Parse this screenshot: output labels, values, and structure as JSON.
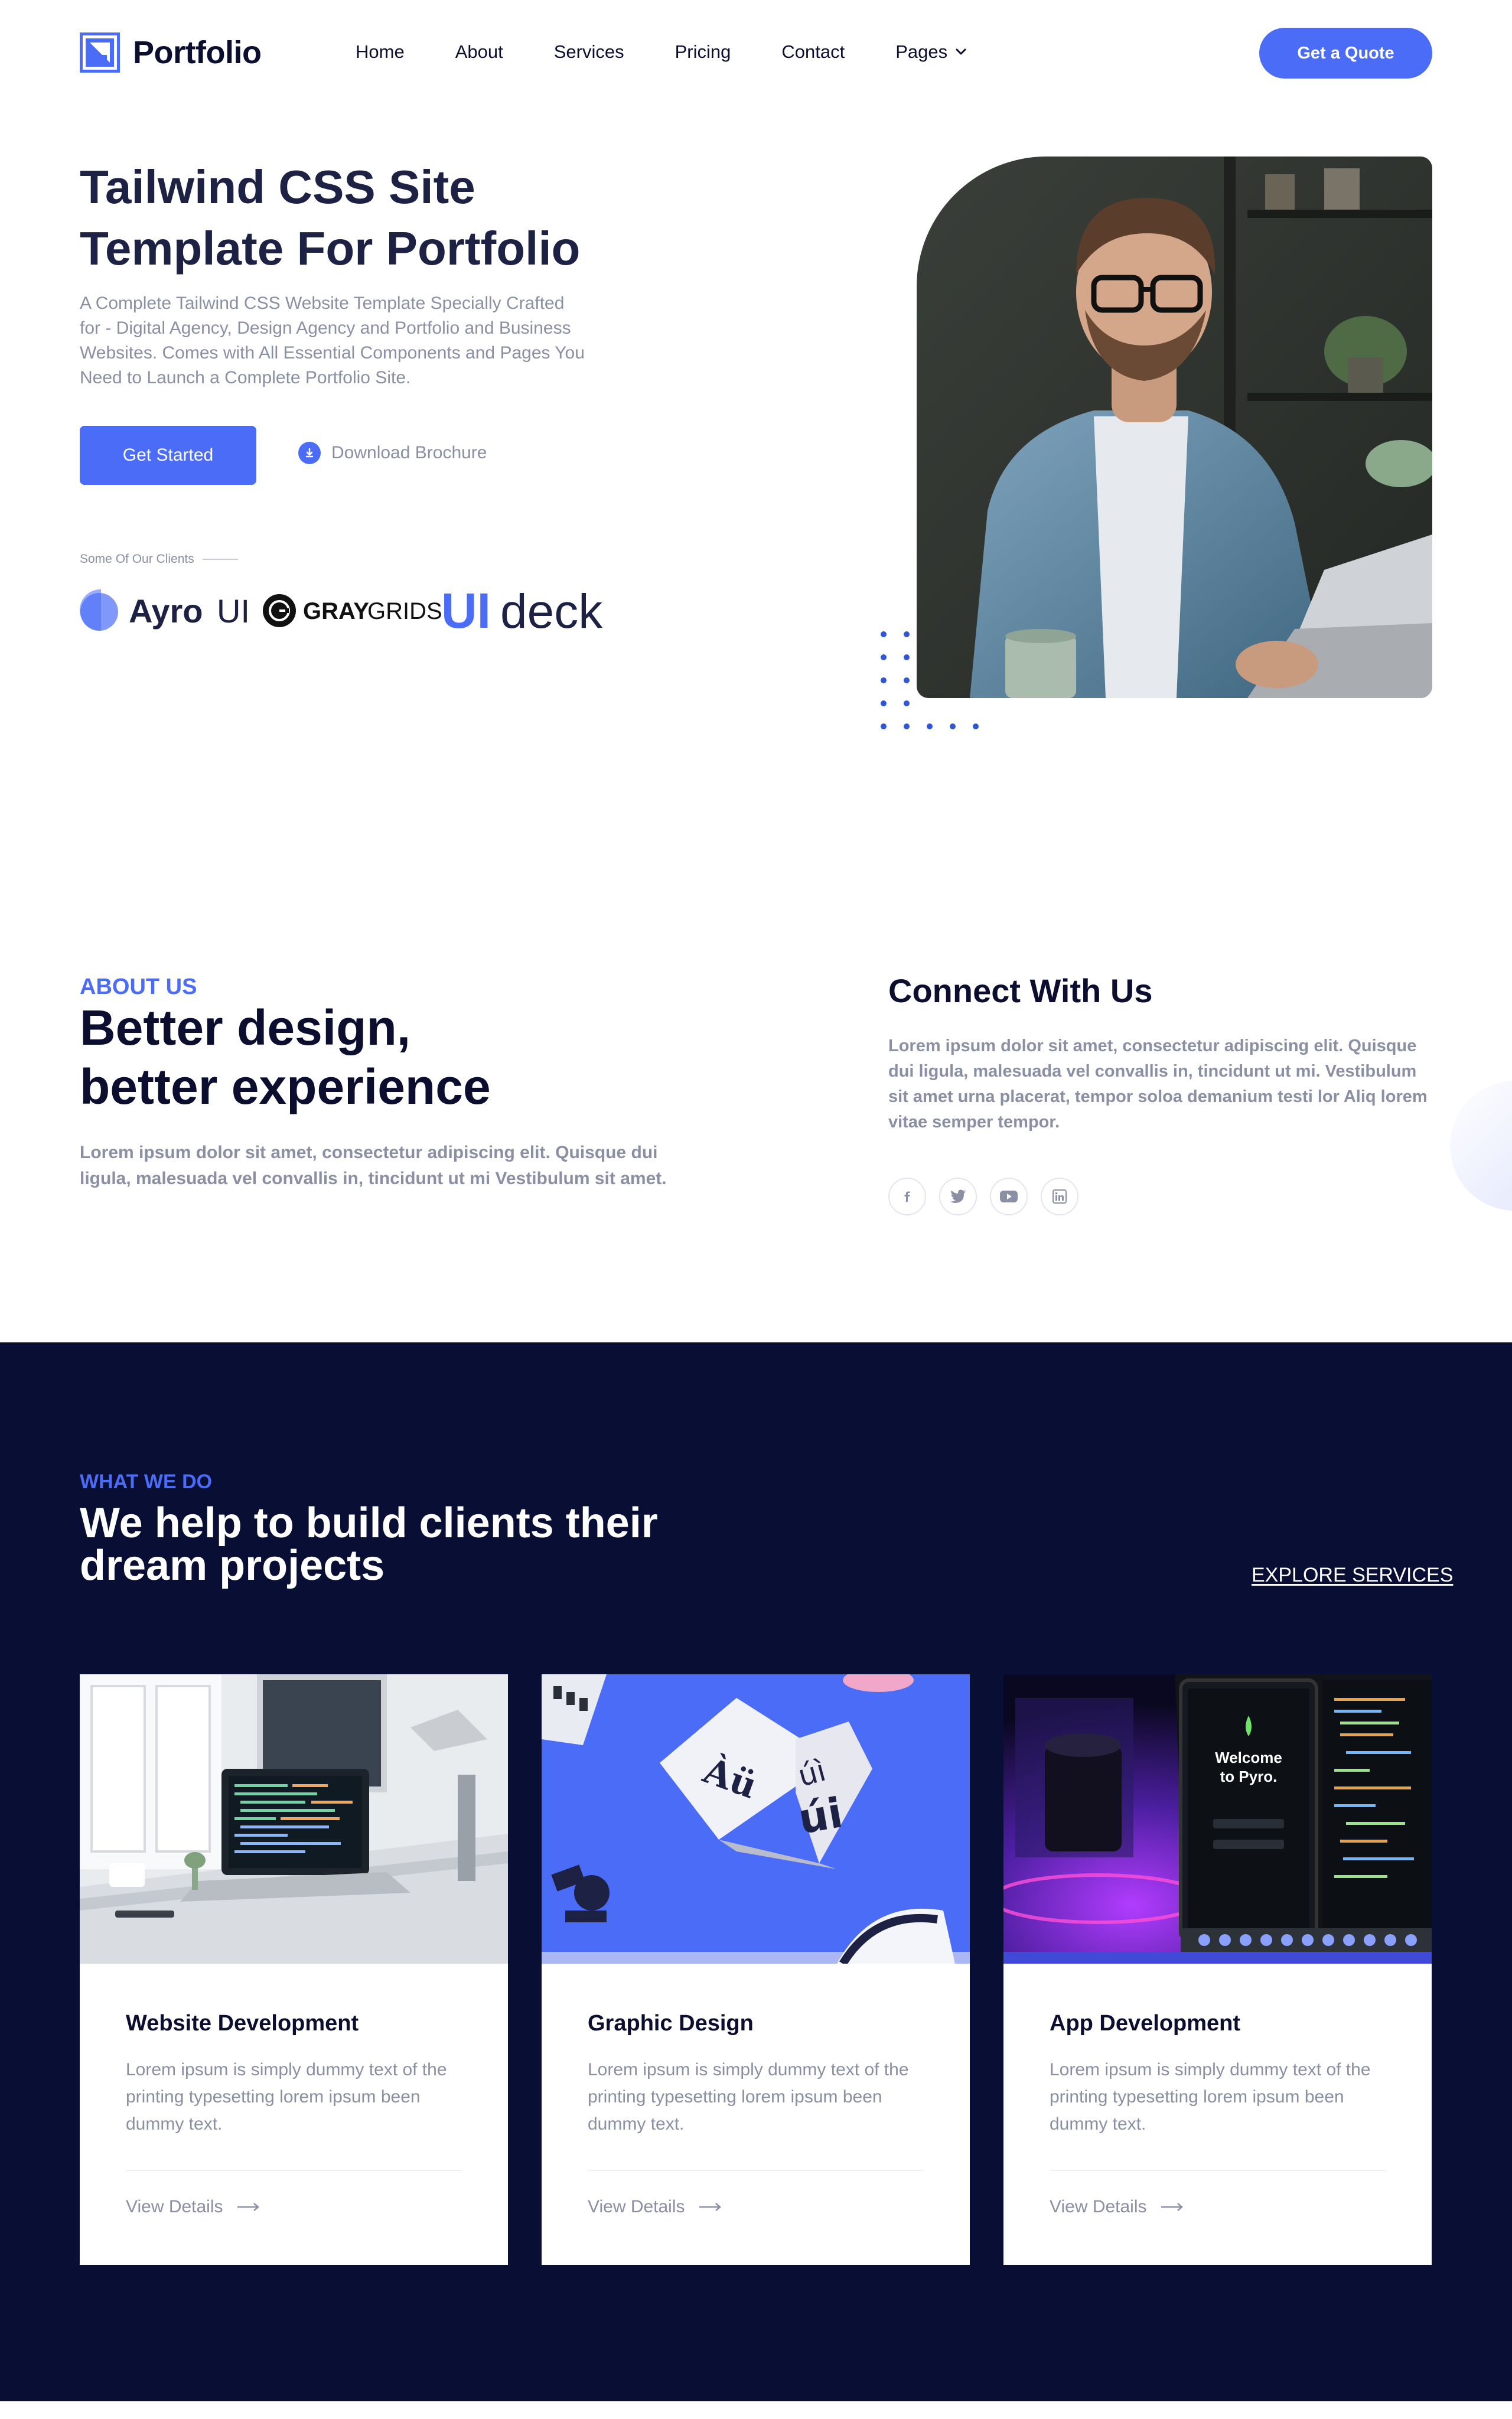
{
  "header": {
    "logo_text": "Portfolio",
    "nav": [
      "Home",
      "About",
      "Services",
      "Pricing",
      "Contact",
      "Pages"
    ],
    "cta_label": "Get a Quote"
  },
  "hero": {
    "title_line1": "Tailwind CSS Site",
    "title_line2": "Template For Portfolio",
    "description": "A Complete Tailwind CSS Website Template Specially Crafted for - Digital Agency, Design Agency and Portfolio and Business Websites. Comes with All Essential Components and Pages You Need to Launch a Complete Portfolio Site.",
    "primary_button": "Get Started",
    "secondary_button": "Download Brochure",
    "clients_label": "Some Of Our Clients",
    "clients": [
      {
        "name_bold": "Ayro",
        "name_light": "UI"
      },
      {
        "name_bold": "GRAY",
        "name_light": "GRIDS"
      },
      {
        "name_bold": "UI",
        "name_light": "deck"
      }
    ]
  },
  "about": {
    "kicker": "ABOUT US",
    "title_line1": "Better design,",
    "title_line2": "better experience",
    "description": "Lorem ipsum dolor sit amet, consectetur adipiscing elit. Quisque dui ligula, malesuada vel convallis in, tincidunt ut mi Vestibulum sit amet.",
    "connect_title": "Connect With Us",
    "connect_description": "Lorem ipsum dolor sit amet, consectetur adipiscing elit. Quisque dui ligula, malesuada vel convallis in, tincidunt ut mi. Vestibulum sit amet urna placerat, tempor soloa demanium testi lor Aliq lorem vitae semper tempor.",
    "socials": [
      "facebook-icon",
      "twitter-icon",
      "youtube-icon",
      "linkedin-icon"
    ]
  },
  "services": {
    "kicker": "WHAT WE DO",
    "title_line1": "We help to build clients their",
    "title_line2": "dream projects",
    "explore_label": "EXPLORE SERVICES",
    "cards": [
      {
        "title": "Website Development",
        "description": "Lorem ipsum is simply dummy text of the printing typesetting lorem ipsum been dummy text.",
        "link": "View Details"
      },
      {
        "title": "Graphic Design",
        "description": "Lorem ipsum is simply dummy text of the printing typesetting lorem ipsum been dummy text.",
        "link": "View Details"
      },
      {
        "title": "App Development",
        "description": "Lorem ipsum is simply dummy text of the printing typesetting lorem ipsum been dummy text.",
        "link": "View Details"
      }
    ],
    "app_screen_line1": "Welcome",
    "app_screen_line2": "to Pyro."
  },
  "colors": {
    "primary": "#4a6cf7",
    "dark": "#0b0e2f",
    "services_bg": "#090e34",
    "muted": "#8a8fa3"
  }
}
